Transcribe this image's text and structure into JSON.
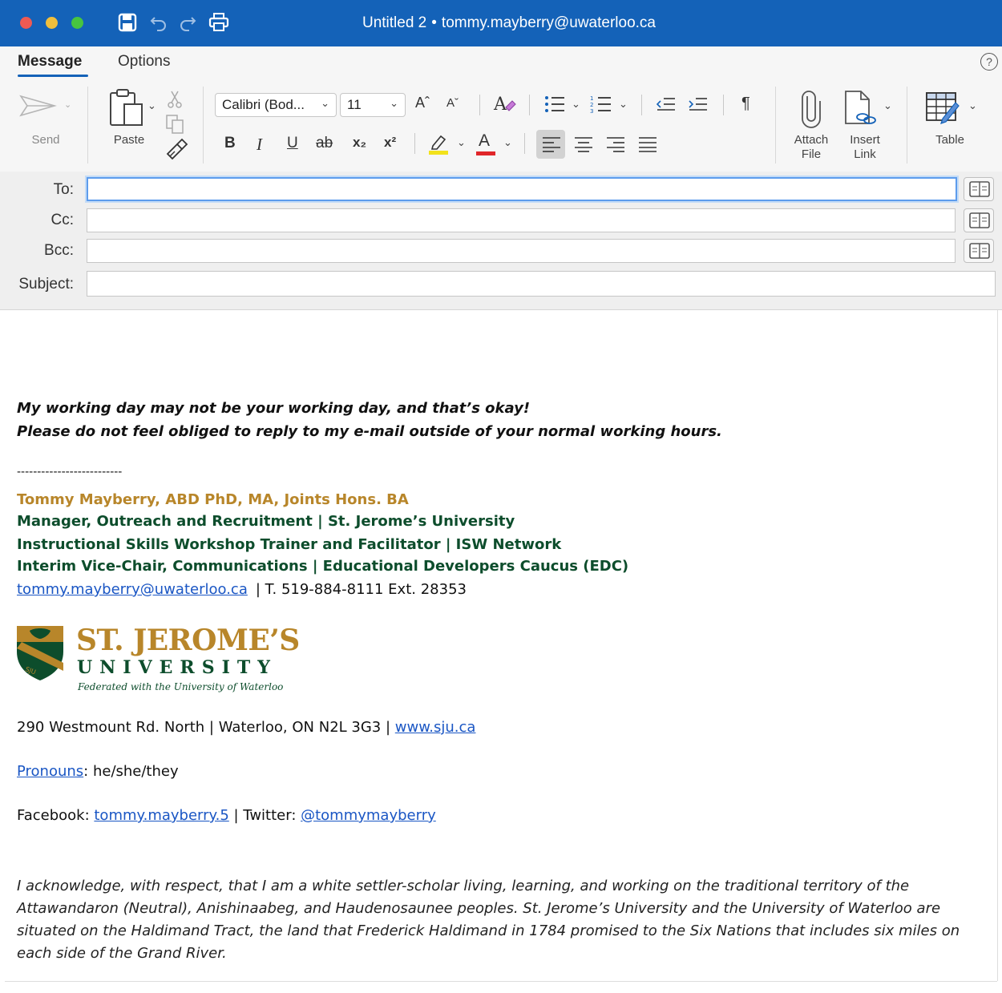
{
  "window": {
    "title": "Untitled 2",
    "account": "tommy.mayberry@uwaterloo.ca",
    "separator": "•"
  },
  "ribbon": {
    "tabs": [
      {
        "label": "Message",
        "active": true
      },
      {
        "label": "Options",
        "active": false
      }
    ],
    "help_label": "?",
    "send_label": "Send",
    "paste_label": "Paste",
    "font_name": "Calibri (Bod...",
    "font_size": "11",
    "grow_font": "Aˆ",
    "shrink_font": "Aˇ",
    "bold_label": "B",
    "italic_label": "I",
    "underline_label": "U",
    "strike_label": "ab",
    "subscript_label": "x₂",
    "superscript_label": "x²",
    "font_color_label": "A",
    "pilcrow_label": "¶",
    "attach_label_1": "Attach",
    "attach_label_2": "File",
    "insert_label_1": "Insert",
    "insert_label_2": "Link",
    "table_label": "Table",
    "highlight_color": "#f2e21c",
    "font_color": "#e0262a"
  },
  "fields": {
    "to_label": "To:",
    "cc_label": "Cc:",
    "bcc_label": "Bcc:",
    "subject_label": "Subject:",
    "to_value": "",
    "cc_value": "",
    "bcc_value": "",
    "subject_value": ""
  },
  "body": {
    "line1": "My working day may not be your working day, and that’s okay!",
    "line2": "Please do not feel obliged to reply to my e-mail outside of your normal working hours.",
    "divider": "--------------------------",
    "sig_name": "Tommy Mayberry, ABD PhD, MA, Joints Hons. BA",
    "sig_role1": "Manager, Outreach and Recruitment | St. Jerome’s University",
    "sig_role2": "Instructional Skills Workshop Trainer and Facilitator | ISW Network",
    "sig_role3": "Interim Vice-Chair, Communications | Educational Developers Caucus (EDC)",
    "email_link": "tommy.mayberry@uwaterloo.ca",
    "phone": "| T. 519-884-8111 Ext. 28353",
    "logo_title": "ST. JEROME’S",
    "logo_subtitle": "UNIVERSITY",
    "logo_tagline": "Federated with the University of Waterloo",
    "address": "290 Westmount Rd. North | Waterloo, ON N2L 3G3 |",
    "website_link": "www.sju.ca",
    "pronouns_link": "Pronouns",
    "pronouns_value": ": he/she/they",
    "facebook_label": "Facebook: ",
    "facebook_link": "tommy.mayberry.5",
    "twitter_label": " | Twitter: ",
    "twitter_link": "@tommymayberry",
    "acknowledgement": "I acknowledge, with respect, that I am a white settler-scholar living, learning, and working on the traditional territory of the Attawandaron (Neutral), Anishinaabeg, and Haudenosaunee peoples. St. Jerome’s University and the University of Waterloo are situated on the Haldimand Tract, the land that Frederick Haldimand in 1784 promised to the Six Nations that includes six miles on each side of the Grand River."
  },
  "colors": {
    "titlebar": "#1462b8",
    "brand_gold": "#b8862a",
    "brand_green": "#0d4d2c",
    "link": "#1a56c4"
  }
}
